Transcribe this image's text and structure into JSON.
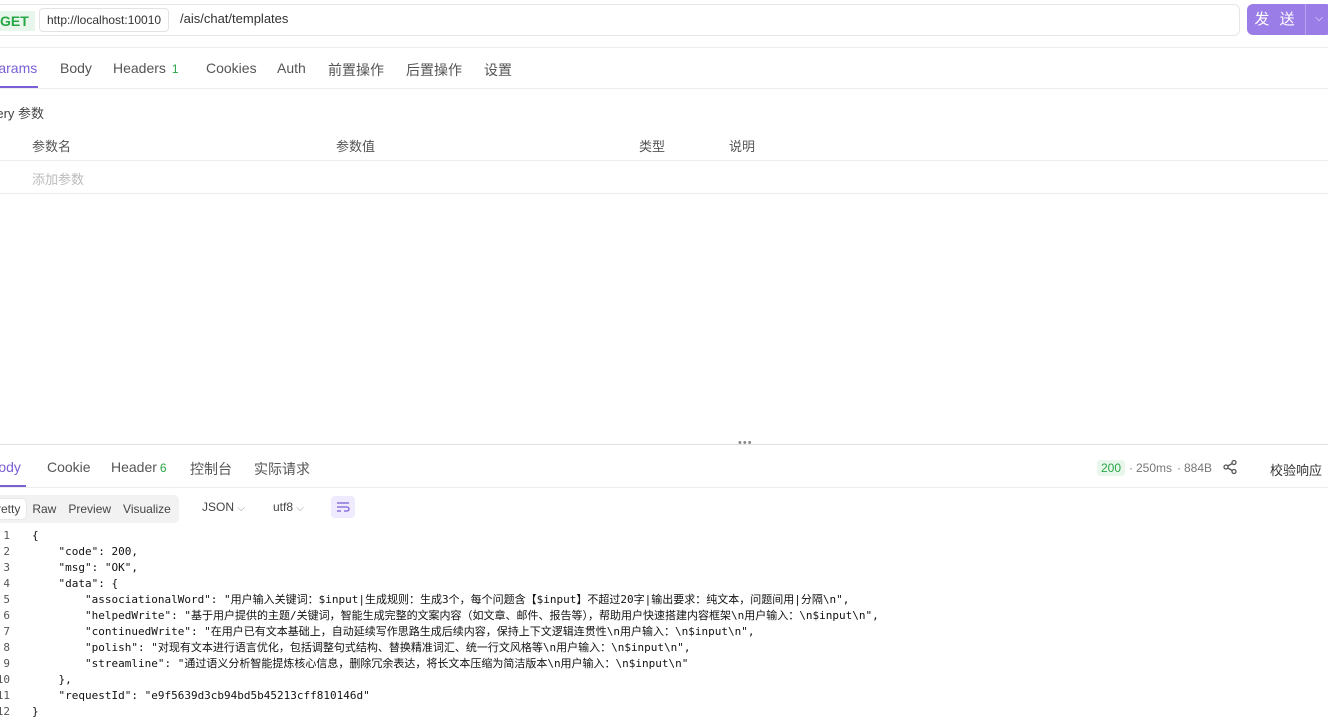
{
  "request": {
    "method": "GET",
    "host": "http://localhost:10010",
    "path": "/ais/chat/templates",
    "send_label": "发 送"
  },
  "req_tabs": [
    {
      "label": "Params"
    },
    {
      "label": "Body"
    },
    {
      "label": "Headers",
      "count": "1"
    },
    {
      "label": "Cookies"
    },
    {
      "label": "Auth"
    },
    {
      "label": "前置操作"
    },
    {
      "label": "后置操作"
    },
    {
      "label": "设置"
    }
  ],
  "query": {
    "title": "Query 参数",
    "columns": [
      "参数名",
      "参数值",
      "类型",
      "说明"
    ],
    "add_placeholder": "添加参数"
  },
  "resp_tabs": [
    {
      "label": "Body"
    },
    {
      "label": "Cookie"
    },
    {
      "label": "Header",
      "count": "6"
    },
    {
      "label": "控制台"
    },
    {
      "label": "实际请求"
    }
  ],
  "response_meta": {
    "status": "200",
    "time": "250ms",
    "size": "884B",
    "verify_label": "校验响应"
  },
  "view_modes": [
    "Pretty",
    "Raw",
    "Preview",
    "Visualize"
  ],
  "format_select": "JSON",
  "encoding_select": "utf8",
  "code_lines": [
    "{",
    "    \"code\": 200,",
    "    \"msg\": \"OK\",",
    "    \"data\": {",
    "        \"associationalWord\": \"用户输入关键词：$input|生成规则：生成3个，每个问题含【$input】不超过20字|输出要求：纯文本，问题间用|分隔\\n\",",
    "        \"helpedWrite\": \"基于用户提供的主题/关键词，智能生成完整的文案内容（如文章、邮件、报告等），帮助用户快速搭建内容框架\\n用户输入：\\n$input\\n\",",
    "        \"continuedWrite\": \"在用户已有文本基础上，自动延续写作思路生成后续内容，保持上下文逻辑连贯性\\n用户输入：\\n$input\\n\",",
    "        \"polish\": \"对现有文本进行语言优化，包括调整句式结构、替换精准词汇、统一行文风格等\\n用户输入：\\n$input\\n\",",
    "        \"streamline\": \"通过语义分析智能提炼核心信息，删除冗余表达，将长文本压缩为简洁版本\\n用户输入：\\n$input\\n\"",
    "    },",
    "    \"requestId\": \"e9f5639d3cb94bd5b45213cff810146d\"",
    "}"
  ],
  "line_numbers": [
    "1",
    "2",
    "3",
    "4",
    "5",
    "6",
    "7",
    "8",
    "9",
    "10",
    "11",
    "12"
  ],
  "colors": {
    "accent": "#7b5fd6",
    "success": "#28a745",
    "send": "#9b7de8"
  }
}
